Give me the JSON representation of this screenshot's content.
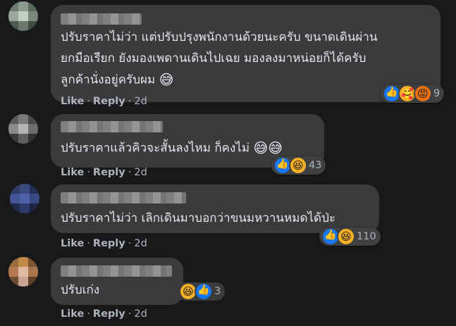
{
  "comments": [
    {
      "text_lines": [
        "ปรับราคาไม่ว่า แต่ปรับปรุงพนักงานด้วยนะครับ ขนาดเดินผ่าน",
        "ยกมือเรียก ยังมองเพดานเดินไปเฉย มองลงมาหน่อยก็ได้ครับ",
        "ลูกค้านั่งอยู่ครับผม"
      ],
      "trailing_emoji": "😅",
      "actions": {
        "like": "Like",
        "reply": "Reply",
        "time": "2d"
      },
      "reaction_icons": [
        "like-icon",
        "care-icon",
        "angry-icon"
      ],
      "reaction_count": "9"
    },
    {
      "text_lines": [
        "ปรับราคาแล้วคิวจะสั้นลงไหม ก็คงไม่"
      ],
      "trailing_emoji": "😅😅",
      "actions": {
        "like": "Like",
        "reply": "Reply",
        "time": "2d"
      },
      "reaction_icons": [
        "like-icon",
        "haha-icon"
      ],
      "reaction_count": "43"
    },
    {
      "text_lines": [
        "ปรับราคาไม่ว่า เลิกเดินมาบอกว่าขนมหวานหมดได้ป่ะ"
      ],
      "trailing_emoji": "",
      "actions": {
        "like": "Like",
        "reply": "Reply",
        "time": "2d"
      },
      "reaction_icons": [
        "like-icon",
        "haha-icon"
      ],
      "reaction_count": "110"
    },
    {
      "text_lines": [
        "ปรับเก่ง"
      ],
      "trailing_emoji": "",
      "actions": {
        "like": "Like",
        "reply": "Reply",
        "time": "2d"
      },
      "reaction_icons": [
        "haha-icon",
        "like-icon"
      ],
      "reaction_count": "3"
    }
  ],
  "colors": {
    "background": "#18191a",
    "bubble": "#3a3b3c",
    "like_blue": "#1877f2",
    "haha_yellow": "#f7b125",
    "angry_orange": "#e9710f"
  }
}
